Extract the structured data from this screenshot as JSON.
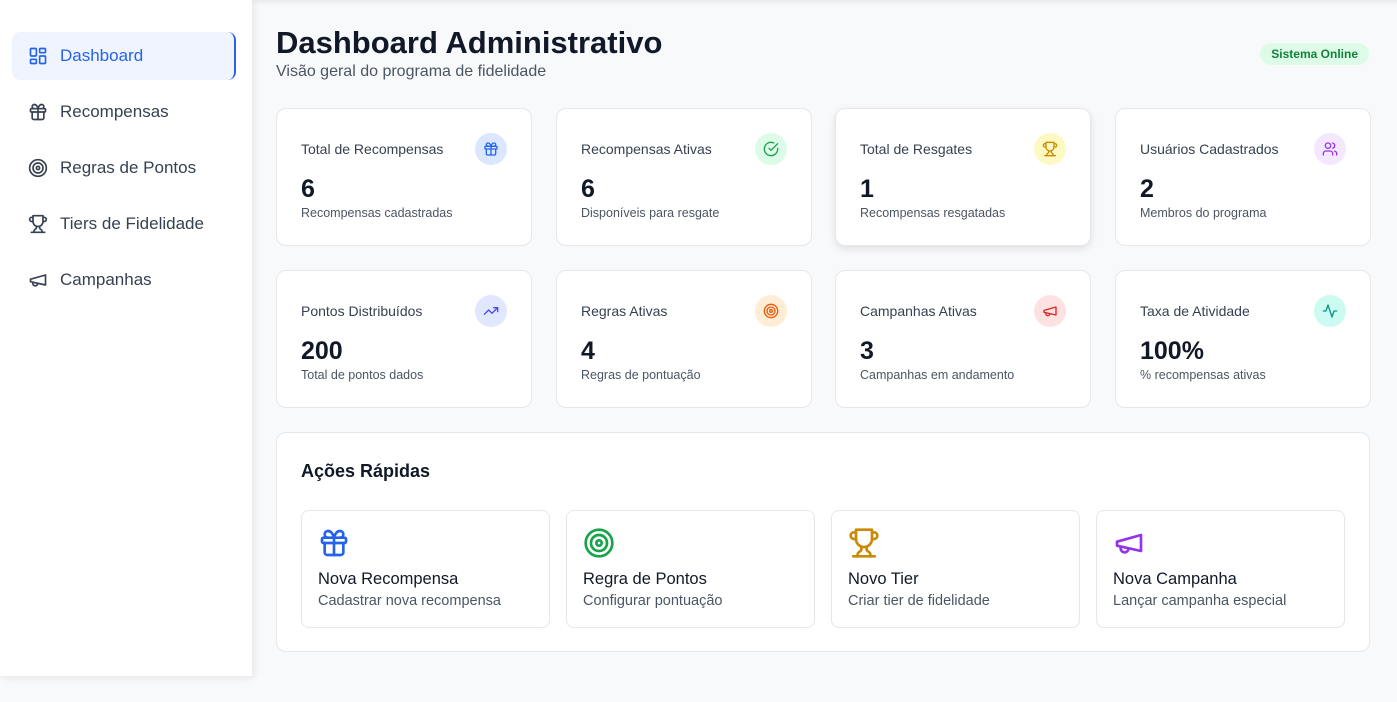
{
  "sidebar": {
    "items": [
      {
        "label": "Dashboard",
        "icon": "layout-grid-icon",
        "active": true
      },
      {
        "label": "Recompensas",
        "icon": "gift-icon"
      },
      {
        "label": "Regras de Pontos",
        "icon": "target-icon"
      },
      {
        "label": "Tiers de Fidelidade",
        "icon": "trophy-icon"
      },
      {
        "label": "Campanhas",
        "icon": "megaphone-icon"
      }
    ]
  },
  "header": {
    "title": "Dashboard Administrativo",
    "subtitle": "Visão geral do programa de fidelidade",
    "status": "Sistema Online"
  },
  "stats": [
    {
      "label": "Total de Recompensas",
      "value": "6",
      "desc": "Recompensas cadastradas",
      "icon": "gift-icon",
      "color": "#2563eb",
      "bg": "#dbe7fe"
    },
    {
      "label": "Recompensas Ativas",
      "value": "6",
      "desc": "Disponíveis para resgate",
      "icon": "check-circle-icon",
      "color": "#16a34a",
      "bg": "#dcfce7"
    },
    {
      "label": "Total de Resgates",
      "value": "1",
      "desc": "Recompensas resgatadas",
      "icon": "trophy-icon",
      "color": "#ca8a04",
      "bg": "#fef9c3"
    },
    {
      "label": "Usuários Cadastrados",
      "value": "2",
      "desc": "Membros do programa",
      "icon": "users-icon",
      "color": "#9333ea",
      "bg": "#f3e8ff"
    },
    {
      "label": "Pontos Distribuídos",
      "value": "200",
      "desc": "Total de pontos dados",
      "icon": "trending-up-icon",
      "color": "#4f46e5",
      "bg": "#e0e7ff"
    },
    {
      "label": "Regras Ativas",
      "value": "4",
      "desc": "Regras de pontuação",
      "icon": "target-icon",
      "color": "#ea580c",
      "bg": "#ffedd5"
    },
    {
      "label": "Campanhas Ativas",
      "value": "3",
      "desc": "Campanhas em andamento",
      "icon": "megaphone-icon",
      "color": "#dc2626",
      "bg": "#fee2e2"
    },
    {
      "label": "Taxa de Atividade",
      "value": "100%",
      "desc": "% recompensas ativas",
      "icon": "activity-icon",
      "color": "#0d9488",
      "bg": "#ccfbf1"
    }
  ],
  "quick_actions": {
    "title": "Ações Rápidas",
    "items": [
      {
        "title": "Nova Recompensa",
        "desc": "Cadastrar nova recompensa",
        "icon": "gift-icon",
        "color": "#2563eb"
      },
      {
        "title": "Regra de Pontos",
        "desc": "Configurar pontuação",
        "icon": "target-icon",
        "color": "#16a34a"
      },
      {
        "title": "Novo Tier",
        "desc": "Criar tier de fidelidade",
        "icon": "trophy-icon",
        "color": "#ca8a04"
      },
      {
        "title": "Nova Campanha",
        "desc": "Lançar campanha especial",
        "icon": "megaphone-icon",
        "color": "#9333ea"
      }
    ]
  }
}
